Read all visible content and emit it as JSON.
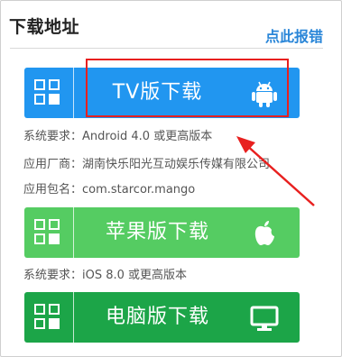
{
  "header": {
    "title": "下载地址",
    "report_link": "点此报错"
  },
  "buttons": {
    "android": {
      "label": "TV版下载",
      "icon": "android-icon",
      "color": "#2196f0"
    },
    "ios": {
      "label": "苹果版下载",
      "icon": "apple-icon",
      "color": "#55cc62"
    },
    "pc": {
      "label": "电脑版下载",
      "icon": "monitor-icon",
      "color": "#1ca548"
    }
  },
  "android_info": {
    "requirement": "系统要求：Android 4.0 或更高版本",
    "vendor": "应用厂商：湖南快乐阳光互动娱乐传媒有限公司",
    "package": "应用包名：com.starcor.mango"
  },
  "ios_info": {
    "requirement": "系统要求：iOS 8.0 或更高版本"
  },
  "annotation": {
    "highlight_color": "#e8201f"
  }
}
